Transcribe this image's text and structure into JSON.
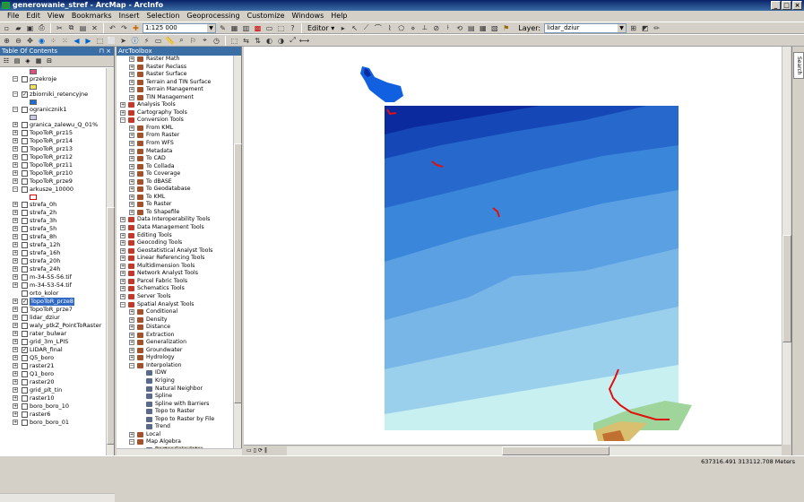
{
  "window": {
    "title": "generowanie_stref - ArcMap - ArcInfo",
    "controls": [
      "_",
      "□",
      "×"
    ]
  },
  "menu": [
    "File",
    "Edit",
    "View",
    "Bookmarks",
    "Insert",
    "Selection",
    "Geoprocessing",
    "Customize",
    "Windows",
    "Help"
  ],
  "toolbar": {
    "scale": "1:125 000",
    "editor_label": "Editor ▾",
    "layer_label": "Layer:",
    "layer_value": "lidar_dziur"
  },
  "toc": {
    "title": "Table Of Contents",
    "selected_label": "TopoToR_prze8",
    "items": [
      {
        "type": "sym",
        "color": "#e05080",
        "expand": ""
      },
      {
        "type": "row",
        "expand": "−",
        "checked": false,
        "label": "przekroje"
      },
      {
        "type": "sym",
        "color": "#f0e060",
        "expand": ""
      },
      {
        "type": "row",
        "expand": "−",
        "checked": true,
        "label": "zbiorniki_retencyjne"
      },
      {
        "type": "sym",
        "color": "#1e6fd0",
        "expand": ""
      },
      {
        "type": "row",
        "expand": "−",
        "checked": false,
        "label": "ogranicznik1"
      },
      {
        "type": "sym",
        "color": "#c8c8e8",
        "expand": ""
      },
      {
        "type": "row",
        "expand": "+",
        "checked": false,
        "label": "granica_zalewu_Q_01%"
      },
      {
        "type": "row",
        "expand": "+",
        "checked": false,
        "label": "TopoToR_prz15"
      },
      {
        "type": "row",
        "expand": "+",
        "checked": false,
        "label": "TopoToR_prz14"
      },
      {
        "type": "row",
        "expand": "+",
        "checked": false,
        "label": "TopoToR_prz13"
      },
      {
        "type": "row",
        "expand": "+",
        "checked": false,
        "label": "TopoToR_prz12"
      },
      {
        "type": "row",
        "expand": "+",
        "checked": false,
        "label": "TopoToR_prz11"
      },
      {
        "type": "row",
        "expand": "+",
        "checked": false,
        "label": "TopoToR_prz10"
      },
      {
        "type": "row",
        "expand": "+",
        "checked": false,
        "label": "TopoToR_prze9"
      },
      {
        "type": "row",
        "expand": "−",
        "checked": false,
        "label": "arkusze_10000"
      },
      {
        "type": "sym",
        "color": "#ffffff",
        "border": "#e00000",
        "expand": ""
      },
      {
        "type": "row",
        "expand": "+",
        "checked": false,
        "label": "strefa_0h"
      },
      {
        "type": "row",
        "expand": "+",
        "checked": false,
        "label": "strefa_2h"
      },
      {
        "type": "row",
        "expand": "+",
        "checked": false,
        "label": "strefa_3h"
      },
      {
        "type": "row",
        "expand": "+",
        "checked": false,
        "label": "strefa_5h"
      },
      {
        "type": "row",
        "expand": "+",
        "checked": false,
        "label": "strefa_8h"
      },
      {
        "type": "row",
        "expand": "+",
        "checked": false,
        "label": "strefa_12h"
      },
      {
        "type": "row",
        "expand": "+",
        "checked": false,
        "label": "strefa_16h"
      },
      {
        "type": "row",
        "expand": "+",
        "checked": false,
        "label": "strefa_20h"
      },
      {
        "type": "row",
        "expand": "+",
        "checked": false,
        "label": "strefa_24h"
      },
      {
        "type": "row",
        "expand": "+",
        "checked": false,
        "label": "m-34-55-56.tif"
      },
      {
        "type": "row",
        "expand": "+",
        "checked": false,
        "label": "m-34-53-54.tif"
      },
      {
        "type": "row",
        "expand": "",
        "checked": false,
        "label": "orto_kolor"
      },
      {
        "type": "row",
        "expand": "+",
        "checked": true,
        "label": "TopoToR_prze8",
        "selected": true
      },
      {
        "type": "row",
        "expand": "+",
        "checked": false,
        "label": "TopoToR_prze7"
      },
      {
        "type": "row",
        "expand": "+",
        "checked": false,
        "label": "lidar_dziur"
      },
      {
        "type": "row",
        "expand": "+",
        "checked": false,
        "label": "waly_ptkZ_PointToRaster"
      },
      {
        "type": "row",
        "expand": "+",
        "checked": false,
        "label": "rater_bulwar"
      },
      {
        "type": "row",
        "expand": "+",
        "checked": false,
        "label": "grid_3m_LPIS"
      },
      {
        "type": "row",
        "expand": "+",
        "checked": true,
        "label": "LIDAR_final"
      },
      {
        "type": "row",
        "expand": "+",
        "checked": false,
        "label": "Q5_boro"
      },
      {
        "type": "row",
        "expand": "+",
        "checked": false,
        "label": "raster21"
      },
      {
        "type": "row",
        "expand": "+",
        "checked": false,
        "label": "Q1_boro"
      },
      {
        "type": "row",
        "expand": "+",
        "checked": false,
        "label": "raster20"
      },
      {
        "type": "row",
        "expand": "+",
        "checked": false,
        "label": "grid_plt_tin"
      },
      {
        "type": "row",
        "expand": "+",
        "checked": false,
        "label": "raster10"
      },
      {
        "type": "row",
        "expand": "+",
        "checked": false,
        "label": "boro_boro_10"
      },
      {
        "type": "row",
        "expand": "+",
        "checked": false,
        "label": "raster6"
      },
      {
        "type": "row",
        "expand": "+",
        "checked": false,
        "label": "boro_boro_01"
      }
    ]
  },
  "arctoolbox": {
    "title": "ArcToolbox",
    "items": [
      {
        "level": 1,
        "kind": "toolset",
        "label": "Raster Math"
      },
      {
        "level": 1,
        "kind": "toolset",
        "label": "Raster Reclass"
      },
      {
        "level": 1,
        "kind": "toolset",
        "label": "Raster Surface"
      },
      {
        "level": 1,
        "kind": "toolset",
        "label": "Terrain and TIN Surface"
      },
      {
        "level": 1,
        "kind": "toolset",
        "label": "Terrain Management"
      },
      {
        "level": 1,
        "kind": "toolset",
        "label": "TIN Management"
      },
      {
        "level": 0,
        "kind": "box",
        "label": "Analysis Tools"
      },
      {
        "level": 0,
        "kind": "box",
        "label": "Cartography Tools"
      },
      {
        "level": 0,
        "kind": "box",
        "label": "Conversion Tools",
        "open": true
      },
      {
        "level": 1,
        "kind": "toolset",
        "label": "From KML"
      },
      {
        "level": 1,
        "kind": "toolset",
        "label": "From Raster"
      },
      {
        "level": 1,
        "kind": "toolset",
        "label": "From WFS"
      },
      {
        "level": 1,
        "kind": "toolset",
        "label": "Metadata"
      },
      {
        "level": 1,
        "kind": "toolset",
        "label": "To CAD"
      },
      {
        "level": 1,
        "kind": "toolset",
        "label": "To Collada"
      },
      {
        "level": 1,
        "kind": "toolset",
        "label": "To Coverage"
      },
      {
        "level": 1,
        "kind": "toolset",
        "label": "To dBASE"
      },
      {
        "level": 1,
        "kind": "toolset",
        "label": "To Geodatabase"
      },
      {
        "level": 1,
        "kind": "toolset",
        "label": "To KML"
      },
      {
        "level": 1,
        "kind": "toolset",
        "label": "To Raster"
      },
      {
        "level": 1,
        "kind": "toolset",
        "label": "To Shapefile"
      },
      {
        "level": 0,
        "kind": "box",
        "label": "Data Interoperability Tools"
      },
      {
        "level": 0,
        "kind": "box",
        "label": "Data Management Tools"
      },
      {
        "level": 0,
        "kind": "box",
        "label": "Editing Tools"
      },
      {
        "level": 0,
        "kind": "box",
        "label": "Geocoding Tools"
      },
      {
        "level": 0,
        "kind": "box",
        "label": "Geostatistical Analyst Tools"
      },
      {
        "level": 0,
        "kind": "box",
        "label": "Linear Referencing Tools"
      },
      {
        "level": 0,
        "kind": "box",
        "label": "Multidimension Tools"
      },
      {
        "level": 0,
        "kind": "box",
        "label": "Network Analyst Tools"
      },
      {
        "level": 0,
        "kind": "box",
        "label": "Parcel Fabric Tools"
      },
      {
        "level": 0,
        "kind": "box",
        "label": "Schematics Tools"
      },
      {
        "level": 0,
        "kind": "box",
        "label": "Server Tools"
      },
      {
        "level": 0,
        "kind": "box",
        "label": "Spatial Analyst Tools",
        "open": true
      },
      {
        "level": 1,
        "kind": "toolset",
        "label": "Conditional"
      },
      {
        "level": 1,
        "kind": "toolset",
        "label": "Density"
      },
      {
        "level": 1,
        "kind": "toolset",
        "label": "Distance"
      },
      {
        "level": 1,
        "kind": "toolset",
        "label": "Extraction"
      },
      {
        "level": 1,
        "kind": "toolset",
        "label": "Generalization"
      },
      {
        "level": 1,
        "kind": "toolset",
        "label": "Groundwater"
      },
      {
        "level": 1,
        "kind": "toolset",
        "label": "Hydrology"
      },
      {
        "level": 1,
        "kind": "toolset",
        "label": "Interpolation",
        "open": true
      },
      {
        "level": 2,
        "kind": "tool",
        "label": "IDW"
      },
      {
        "level": 2,
        "kind": "tool",
        "label": "Kriging"
      },
      {
        "level": 2,
        "kind": "tool",
        "label": "Natural Neighbor"
      },
      {
        "level": 2,
        "kind": "tool",
        "label": "Spline"
      },
      {
        "level": 2,
        "kind": "tool",
        "label": "Spline with Barriers"
      },
      {
        "level": 2,
        "kind": "tool",
        "label": "Topo to Raster"
      },
      {
        "level": 2,
        "kind": "tool",
        "label": "Topo to Raster by File"
      },
      {
        "level": 2,
        "kind": "tool",
        "label": "Trend"
      },
      {
        "level": 1,
        "kind": "toolset",
        "label": "Local"
      },
      {
        "level": 1,
        "kind": "toolset",
        "label": "Map Algebra",
        "open": true
      },
      {
        "level": 2,
        "kind": "tool",
        "label": "Raster Calculator",
        "selected": true
      }
    ]
  },
  "side_dock": {
    "search_label": "Search"
  },
  "status": {
    "coordinates": "637316.491  313112.708 Meters"
  },
  "colors": {
    "titlebar": "#0a246a",
    "selection": "#316ac5",
    "map_dark": "#0a1f9e",
    "map_light": "#c8f0f0",
    "red_lines": "#e01010"
  }
}
